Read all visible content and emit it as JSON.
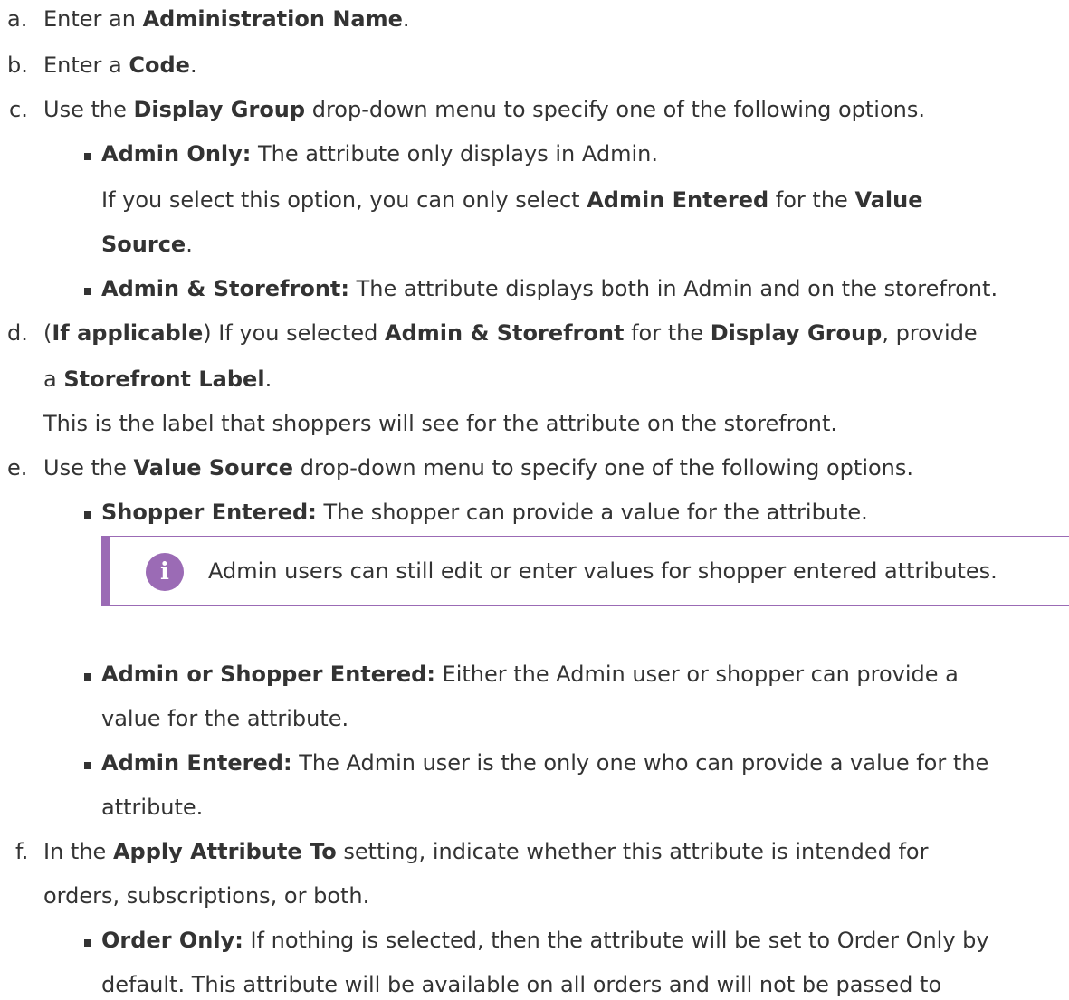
{
  "steps": {
    "a": {
      "marker": "a.",
      "pre": "Enter an ",
      "bold": "Administration Name",
      "post": "."
    },
    "b": {
      "marker": "b.",
      "pre": "Enter a ",
      "bold": "Code",
      "post": "."
    },
    "c": {
      "marker": "c.",
      "pre": "Use the ",
      "bold": "Display Group",
      "post": " drop-down menu to specify one of the following options.",
      "options": [
        {
          "label": "Admin Only:",
          "text": " The attribute only displays in Admin.",
          "extra": {
            "pre": "If you select this option, you can only select ",
            "bold1": "Admin Entered",
            "mid": " for the ",
            "bold2": "Value",
            "bold3": "Source",
            "post": "."
          }
        },
        {
          "label": "Admin & Storefront:",
          "text": " The attribute displays both in Admin and on the storefront."
        }
      ]
    },
    "d": {
      "marker": "d.",
      "open": "(",
      "bold_applicable": "If applicable",
      "close": ") If you selected ",
      "bold1": "Admin & Storefront",
      "mid": " for the ",
      "bold2": "Display Group",
      "tail": ", provide",
      "line2_pre": "a ",
      "line2_bold": "Storefront Label",
      "line2_post": ".",
      "note": "This is the label that shoppers will see for the attribute on the storefront."
    },
    "e": {
      "marker": "e.",
      "pre": "Use the ",
      "bold": "Value Source",
      "post": " drop-down menu to specify one of the following options.",
      "options": [
        {
          "label": "Shopper Entered:",
          "text": " The shopper can provide a value for the attribute."
        },
        {
          "label": "Admin or Shopper Entered:",
          "text_line1": " Either the Admin user or shopper can provide a",
          "text_line2": "value for the attribute."
        },
        {
          "label": "Admin Entered:",
          "text_line1": " The Admin user is the only one who can provide a value for the",
          "text_line2": "attribute."
        }
      ],
      "info": {
        "icon": "info-icon",
        "glyph": "i",
        "text": "Admin users can still edit or enter values for shopper entered attributes.",
        "accent": "#9b6bb5"
      }
    },
    "f": {
      "marker": "f.",
      "pre": "In the ",
      "bold": "Apply Attribute To",
      "post": " setting, indicate whether this attribute is intended for",
      "line2": "orders, subscriptions, or both.",
      "options": [
        {
          "label": "Order Only:",
          "text_line1": " If nothing is selected, then the attribute will be set to Order Only by",
          "text_line2": "default. This attribute will be available on all orders and will not be passed to"
        }
      ]
    }
  }
}
